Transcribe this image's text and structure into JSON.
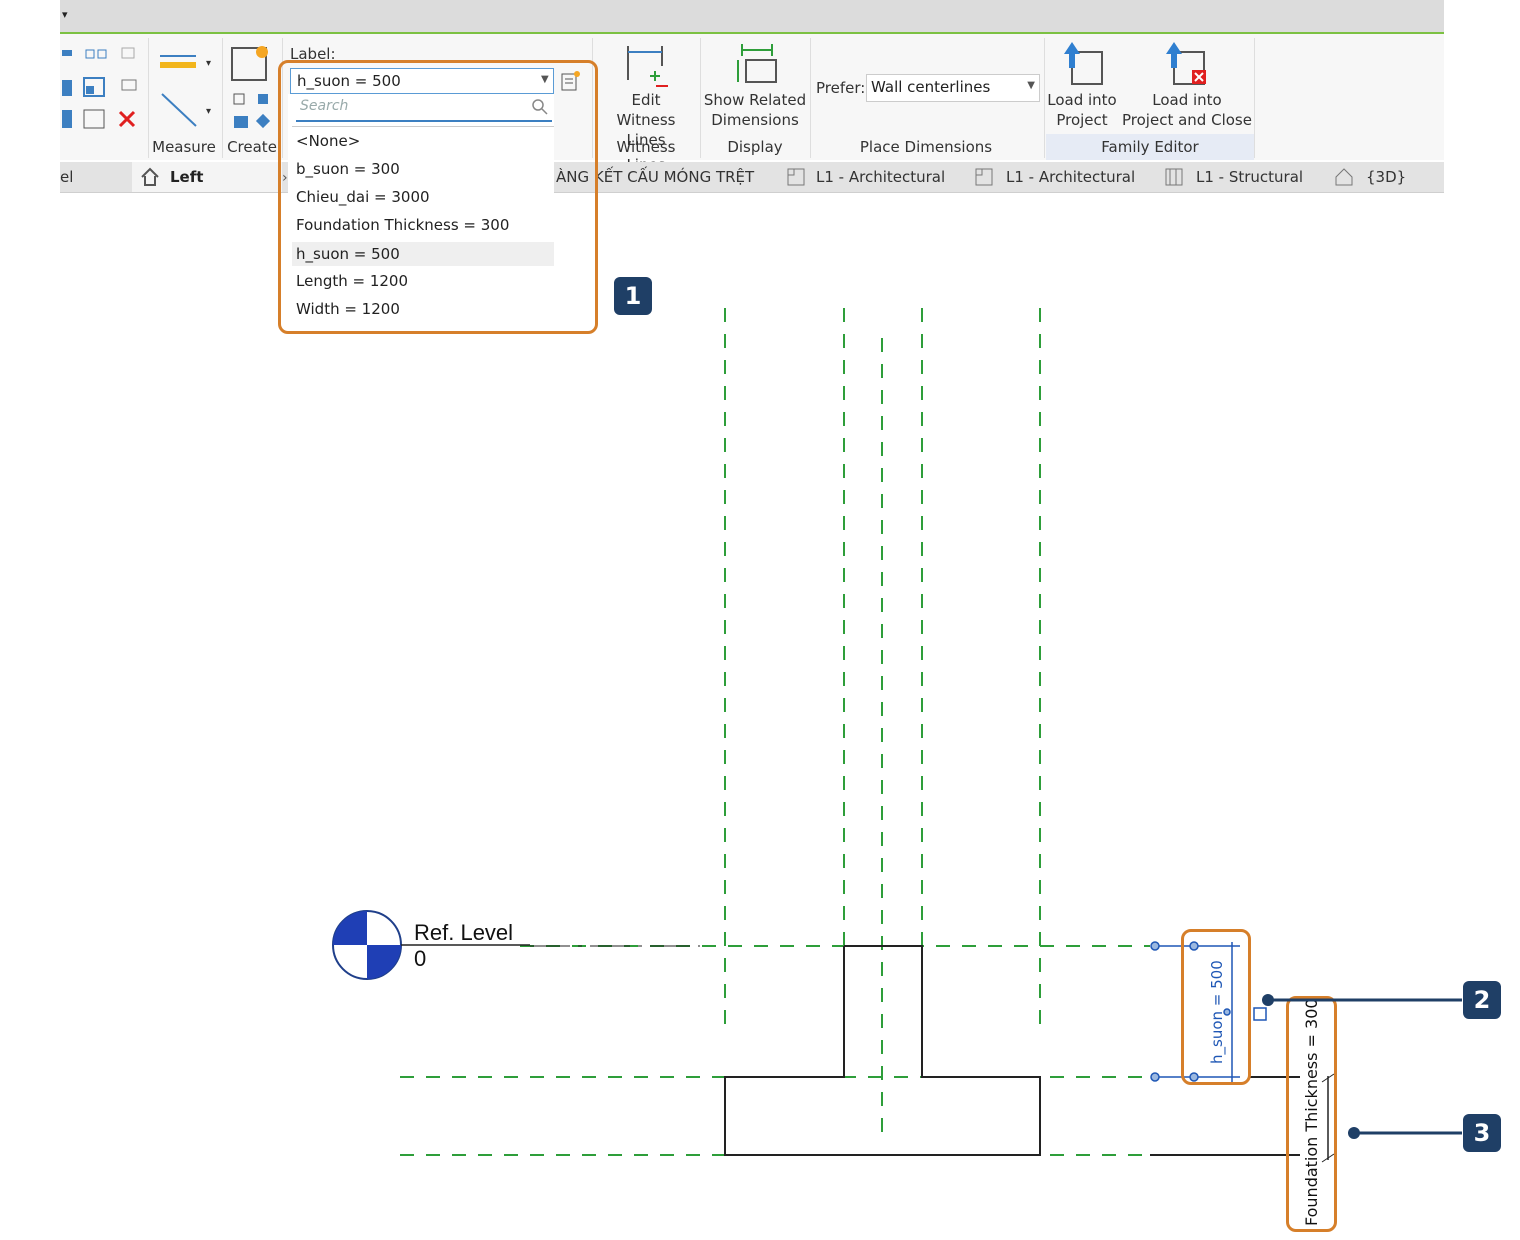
{
  "ribbon": {
    "label_caption": "Label:",
    "measure": "Measure",
    "create": "Create",
    "edit_witness_1": "Edit",
    "edit_witness_2": "Witness Lines",
    "show_related_1": "Show Related",
    "show_related_2": "Dimensions",
    "prefer_label": "Prefer:",
    "prefer_value": "Wall centerlines",
    "load_into_1": "Load into",
    "load_into_2": "Project",
    "load_close_1": "Load into",
    "load_close_2": "Project and Close",
    "panels": {
      "witness_lines": "Witness Lines",
      "display": "Display",
      "place_dimensions": "Place Dimensions",
      "family_editor": "Family Editor"
    }
  },
  "label_combo": {
    "value": "h_suon = 500",
    "search_placeholder": "Search",
    "options": [
      "<None>",
      "b_suon = 300",
      "Chieu_dai = 3000",
      "Foundation Thickness = 300",
      "h_suon = 500",
      "Length = 1200",
      "Width = 1200"
    ],
    "selected_index": 4
  },
  "view_tabs": {
    "left": "Left",
    "t1": "ÀNG KẾT CẤU MÓNG TRỆT",
    "t2": "L1 - Architectural",
    "t3": "L1 - Architectural",
    "t4": "L1 - Structural",
    "t5": "{3D}",
    "truncated_start": "el"
  },
  "drawing": {
    "ref_level_name": "Ref. Level",
    "ref_level_value": "0",
    "dim_h_suon": "h_suon = 500",
    "dim_foundation": "Foundation Thickness = 300"
  },
  "callouts": [
    "1",
    "2",
    "3"
  ],
  "colors": {
    "accent_orange": "#d67f2a",
    "badge_navy": "#1f3f66",
    "ref_plane_green": "#2e9e3a",
    "dimension_blue": "#1f57b5"
  }
}
